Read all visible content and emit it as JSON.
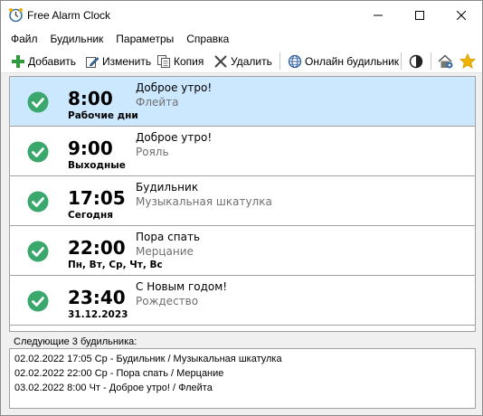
{
  "window": {
    "title": "Free Alarm Clock"
  },
  "menu": [
    "Файл",
    "Будильник",
    "Параметры",
    "Справка"
  ],
  "toolbar": {
    "add_label": "Добавить",
    "edit_label": "Изменить",
    "copy_label": "Копия",
    "delete_label": "Удалить",
    "online_label": "Онлайн будильник"
  },
  "alarms": [
    {
      "time": "8:00",
      "days": "Рабочие дни",
      "label": "Доброе утро!",
      "sound": "Флейта",
      "enabled": true,
      "selected": true
    },
    {
      "time": "9:00",
      "days": "Выходные",
      "label": "Доброе утро!",
      "sound": "Рояль",
      "enabled": true,
      "selected": false
    },
    {
      "time": "17:05",
      "days": "Сегодня",
      "label": "Будильник",
      "sound": "Музыкальная шкатулка",
      "enabled": true,
      "selected": false
    },
    {
      "time": "22:00",
      "days": "Пн, Вт, Ср, Чт, Вс",
      "label": "Пора спать",
      "sound": "Мерцание",
      "enabled": true,
      "selected": false
    },
    {
      "time": "23:40",
      "days": "31.12.2023",
      "label": "С Новым годом!",
      "sound": "Рождество",
      "enabled": true,
      "selected": false
    }
  ],
  "next": {
    "caption": "Следующие 3 будильника:",
    "lines": [
      "02.02.2022 17:05 Ср - Будильник / Музыкальная шкатулка",
      "02.02.2022 22:00 Ср - Пора спать / Мерцание",
      "03.02.2022 8:00 Чт - Доброе утро! / Флейта"
    ]
  },
  "colors": {
    "selected_row": "#cce8ff",
    "check_green": "#3aa76d",
    "add_green": "#2e9b3f",
    "star": "#f0b400"
  },
  "icons": {
    "app": "alarm-clock-icon",
    "add": "plus-icon",
    "edit": "pencil-icon",
    "copy": "copy-icon",
    "delete": "x-icon",
    "online": "globe-icon",
    "theme": "contrast-icon",
    "home": "home-settings-icon",
    "favorite": "star-icon",
    "check": "check-circle-icon"
  }
}
